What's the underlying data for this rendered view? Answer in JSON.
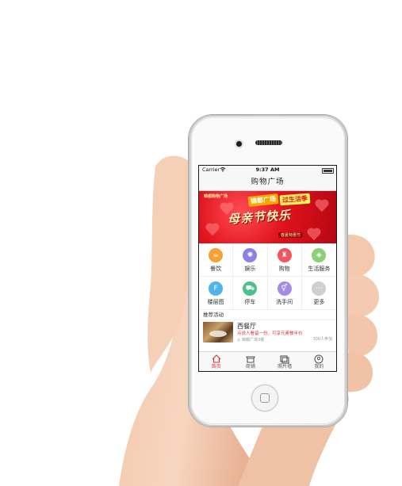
{
  "status_bar": {
    "carrier": "Carrier",
    "time": "9:37 AM"
  },
  "nav": {
    "title": "购物广场"
  },
  "banner": {
    "brand": "锦都购物广场",
    "tag_left": "锦都广场",
    "tag_right": "过生活季",
    "headline": "母亲节快乐",
    "subline": "春夏特惠节"
  },
  "categories": [
    {
      "label": "餐饮",
      "icon": "coffee-cup-icon",
      "color": "#f4a235",
      "glyph": "☕"
    },
    {
      "label": "娱乐",
      "icon": "film-reel-icon",
      "color": "#8d7fe4",
      "glyph": "✺"
    },
    {
      "label": "购物",
      "icon": "shopping-bag-icon",
      "color": "#f2555f",
      "glyph": "♜"
    },
    {
      "label": "生活服务",
      "icon": "tag-icon",
      "color": "#8bcf78",
      "glyph": "◈"
    },
    {
      "label": "楼层图",
      "icon": "floor-map-icon",
      "color": "#4fb4ee",
      "glyph": "F"
    },
    {
      "label": "停车",
      "icon": "car-icon",
      "color": "#4ec08b",
      "glyph": "⛟"
    },
    {
      "label": "洗手间",
      "icon": "restroom-icon",
      "color": "#a48be6",
      "glyph": "⚥"
    },
    {
      "label": "更多",
      "icon": "more-icon",
      "color": "#cfcfcf",
      "glyph": "⋯"
    }
  ],
  "section": {
    "title": "推荐活动"
  },
  "recommendation": {
    "title": "西餐厅",
    "desc": "点说人看留一份，可享元素餐半价",
    "location": "锦都广场3楼",
    "distance": "300人参加"
  },
  "tabs": [
    {
      "label": "首页",
      "icon": "home-icon",
      "active": true
    },
    {
      "label": "商铺",
      "icon": "store-icon",
      "active": false
    },
    {
      "label": "照片墙",
      "icon": "photo-wall-icon",
      "active": false
    },
    {
      "label": "我的",
      "icon": "user-icon",
      "active": false
    }
  ],
  "colors": {
    "accent": "#e0313a",
    "banner_red": "#e0121c"
  }
}
